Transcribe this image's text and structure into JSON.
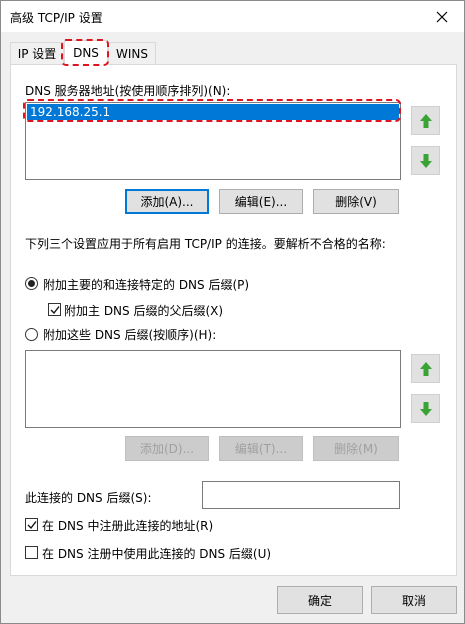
{
  "window": {
    "title": "高级 TCP/IP 设置"
  },
  "tabs": [
    {
      "label": "IP 设置"
    },
    {
      "label": "DNS"
    },
    {
      "label": "WINS"
    }
  ],
  "dns_servers": {
    "label": "DNS 服务器地址(按使用顺序排列)(N):",
    "items": [
      "192.168.25.1"
    ],
    "add_label": "添加(A)...",
    "edit_label": "编辑(E)...",
    "delete_label": "删除(V)"
  },
  "resolution_note": "下列三个设置应用于所有启用 TCP/IP 的连接。要解析不合格的名称:",
  "options": {
    "append_primary": "附加主要的和连接特定的 DNS 后缀(P)",
    "append_parent": "附加主 DNS 后缀的父后缀(X)",
    "append_these": "附加这些 DNS 后缀(按顺序)(H):"
  },
  "suffix_list": {
    "add_label": "添加(D)...",
    "edit_label": "编辑(T)...",
    "delete_label": "删除(M)"
  },
  "connection_suffix": {
    "label": "此连接的 DNS 后缀(S):",
    "value": ""
  },
  "register": {
    "register_address": "在 DNS 中注册此连接的地址(R)",
    "use_suffix": "在 DNS 注册中使用此连接的 DNS 后缀(U)"
  },
  "footer": {
    "ok_label": "确定",
    "cancel_label": "取消"
  },
  "colors": {
    "selection": "#0078d7",
    "annotation": "#e0141e",
    "arrow_green": "#3aa335"
  }
}
